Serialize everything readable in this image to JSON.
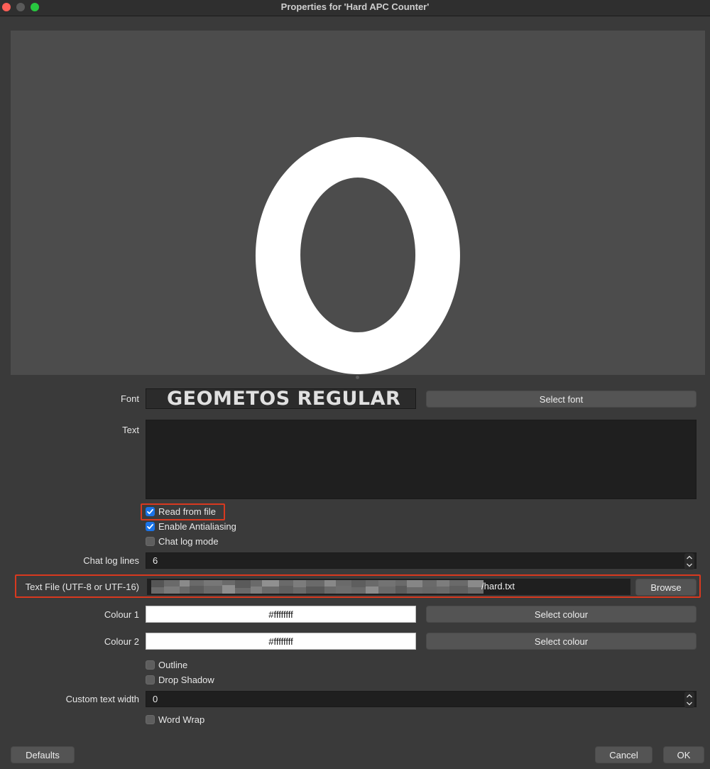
{
  "window": {
    "title": "Properties for 'Hard APC Counter'"
  },
  "preview": {
    "text": "0",
    "text_color": "#ffffff",
    "background": "#4c4c4c"
  },
  "font": {
    "label": "Font",
    "preview": "GEOMETOS REGULAR",
    "select_button": "Select font"
  },
  "text": {
    "label": "Text",
    "value": ""
  },
  "checkboxes": {
    "read_from_file": {
      "label": "Read from file",
      "checked": true
    },
    "antialiasing": {
      "label": "Enable Antialiasing",
      "checked": true
    },
    "chat_log_mode": {
      "label": "Chat log mode",
      "checked": false
    },
    "outline": {
      "label": "Outline",
      "checked": false
    },
    "drop_shadow": {
      "label": "Drop Shadow",
      "checked": false
    },
    "word_wrap": {
      "label": "Word Wrap",
      "checked": false
    }
  },
  "chat_log_lines": {
    "label": "Chat log lines",
    "value": "6"
  },
  "text_file": {
    "label": "Text File (UTF-8 or UTF-16)",
    "path_suffix": "/hard.txt",
    "browse_button": "Browse"
  },
  "colour1": {
    "label": "Colour 1",
    "value": "#ffffffff",
    "button": "Select colour"
  },
  "colour2": {
    "label": "Colour 2",
    "value": "#ffffffff",
    "button": "Select colour"
  },
  "custom_text_width": {
    "label": "Custom text width",
    "value": "0"
  },
  "footer": {
    "defaults": "Defaults",
    "cancel": "Cancel",
    "ok": "OK"
  },
  "colors": {
    "highlight": "#d8391f",
    "checkbox_accent": "#1a73e8"
  }
}
